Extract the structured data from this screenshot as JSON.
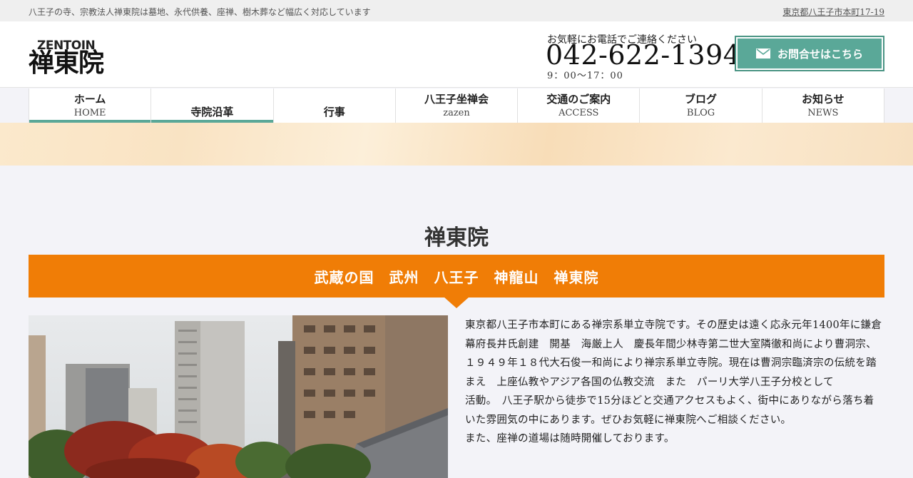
{
  "topbar": {
    "tagline": "八王子の寺、宗教法人禅東院は墓地、永代供養、座禅、樹木葬など幅広く対応しています",
    "address": "東京都八王子市本町17-19"
  },
  "header": {
    "logo_en": "ZENTOIN",
    "logo_jp": "禅東院",
    "contact_lead": "お気軽にお電話でご連絡ください",
    "phone": "042-622-1394",
    "hours": "9：00〜17：00",
    "contact_button": "お問合せはこちら",
    "contact_icon": "mail-icon"
  },
  "nav": {
    "items": [
      {
        "jp": "ホーム",
        "en": "HOME"
      },
      {
        "jp": "寺院沿革",
        "en": ""
      },
      {
        "jp": "行事",
        "en": ""
      },
      {
        "jp": "八王子坐禅会",
        "en": "zazen"
      },
      {
        "jp": "交通のご案内",
        "en": "ACCESS"
      },
      {
        "jp": "ブログ",
        "en": "BLOG"
      },
      {
        "jp": "お知らせ",
        "en": "NEWS"
      }
    ]
  },
  "main": {
    "title": "禅東院",
    "banner_text": "武蔵の国　武州　八王子　神龍山　禅東院",
    "paragraphs": [
      "東京都八王子市本町にある禅宗系単立寺院です。その歴史は遠く応永元年1400年に鎌倉幕府長井氏創建　開基　海厳上人　慶長年間少林寺第二世大室隣徹和尚により曹洞宗、１９４９年１８代大石俊一和尚により禅宗系単立寺院。現在は曹洞宗臨済宗の伝統を踏まえ　上座仏教やアジア各国の仏教交流　また　パーリ大学八王子分校として",
      "活動。　八王子駅から徒歩で15分ほどと交通アクセスもよく、街中にありながら落ち着いた雰囲気の中にあります。ぜひお気軽に禅東院へご相談ください。",
      "また、座禅の道場は随時開催しております。"
    ]
  },
  "colors": {
    "accent_green": "#5aa898",
    "accent_orange": "#f07d06"
  }
}
